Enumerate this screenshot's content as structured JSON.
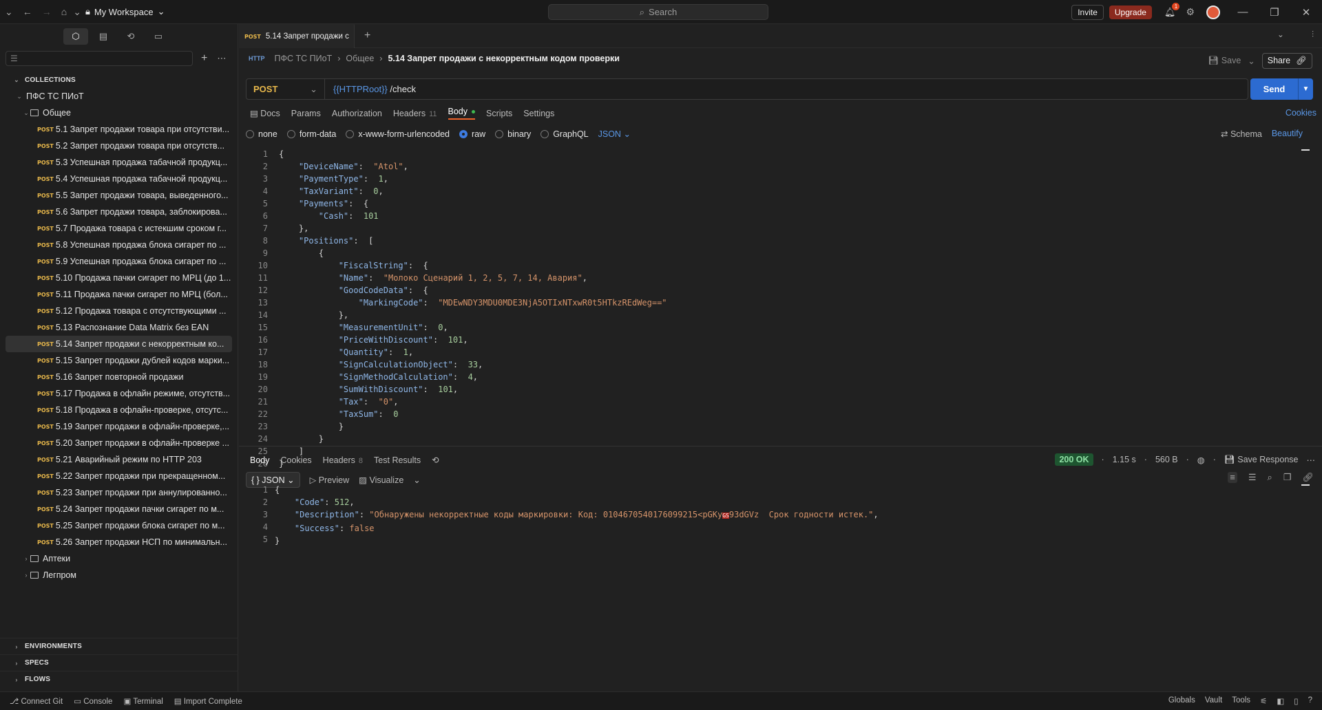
{
  "titlebar": {
    "workspace": "My Workspace",
    "search_placeholder": "Search",
    "invite": "Invite",
    "upgrade": "Upgrade",
    "notif_count": "1"
  },
  "sidebar": {
    "collections_label": "COLLECTIONS",
    "collection_name": "ПФС ТС ПИоТ",
    "folder_name": "Общее",
    "requests": [
      {
        "method": "POST",
        "name": "5.1 Запрет продажи товара при отсутстви..."
      },
      {
        "method": "POST",
        "name": "5.2 Запрет продажи товара при отсутств..."
      },
      {
        "method": "POST",
        "name": "5.3 Успешная продажа табачной продукц..."
      },
      {
        "method": "POST",
        "name": "5.4 Успешная продажа табачной продукц..."
      },
      {
        "method": "POST",
        "name": "5.5 Запрет продажи товара, выведенного..."
      },
      {
        "method": "POST",
        "name": "5.6 Запрет продажи товара, заблокирова..."
      },
      {
        "method": "POST",
        "name": "5.7 Продажа товара с истекшим сроком г..."
      },
      {
        "method": "POST",
        "name": "5.8 Успешная продажа блока сигарет по ..."
      },
      {
        "method": "POST",
        "name": "5.9 Успешная продажа блока сигарет по ..."
      },
      {
        "method": "POST",
        "name": "5.10 Продажа пачки сигарет по МРЦ (до 1..."
      },
      {
        "method": "POST",
        "name": "5.11 Продажа пачки сигарет по МРЦ (бол..."
      },
      {
        "method": "POST",
        "name": "5.12 Продажа товара с отсутствующими ..."
      },
      {
        "method": "POST",
        "name": "5.13 Распознание Data Matrix без EAN"
      },
      {
        "method": "POST",
        "name": "5.14 Запрет продажи с некорректным ко..."
      },
      {
        "method": "POST",
        "name": "5.15 Запрет продажи дублей кодов марки..."
      },
      {
        "method": "POST",
        "name": "5.16 Запрет повторной продажи"
      },
      {
        "method": "POST",
        "name": "5.17 Продажа в офлайн режиме, отсутств..."
      },
      {
        "method": "POST",
        "name": "5.18 Продажа в офлайн-проверке, отсутс..."
      },
      {
        "method": "POST",
        "name": "5.19 Запрет продажи в офлайн-проверке,..."
      },
      {
        "method": "POST",
        "name": "5.20 Запрет продажи в офлайн-проверке ..."
      },
      {
        "method": "POST",
        "name": "5.21 Аварийный режим по HTTP 203"
      },
      {
        "method": "POST",
        "name": "5.22 Запрет продажи при прекращенном..."
      },
      {
        "method": "POST",
        "name": "5.23 Запрет продажи при аннулированно..."
      },
      {
        "method": "POST",
        "name": "5.24 Запрет продажи пачки сигарет по м..."
      },
      {
        "method": "POST",
        "name": "5.25 Запрет продажи блока сигарет по м..."
      },
      {
        "method": "POST",
        "name": "5.26 Запрет продажи НСП по минимальн..."
      }
    ],
    "other_folders": [
      "Аптеки",
      "Легпром"
    ],
    "bottom_sections": [
      "ENVIRONMENTS",
      "SPECS",
      "FLOWS"
    ]
  },
  "tab": {
    "method": "POST",
    "title": "5.14 Запрет продажи с"
  },
  "breadcrumb": {
    "collection": "ПФС ТС ПИоТ",
    "folder": "Общее",
    "request": "5.14 Запрет продажи с некорректным кодом проверки"
  },
  "request": {
    "save": "Save",
    "share": "Share",
    "method": "POST",
    "url_var": "{{HTTPRoot}}",
    "url_path": " /check",
    "send": "Send",
    "subtabs": {
      "docs": "Docs",
      "params": "Params",
      "authorization": "Authorization",
      "headers": "Headers",
      "headers_count": "11",
      "body": "Body",
      "scripts": "Scripts",
      "settings": "Settings"
    },
    "cookies": "Cookies",
    "body_types": {
      "none": "none",
      "form_data": "form-data",
      "urlencoded": "x-www-form-urlencoded",
      "raw": "raw",
      "binary": "binary",
      "graphql": "GraphQL",
      "format": "JSON"
    },
    "schema": "Schema",
    "beautify": "Beautify"
  },
  "response": {
    "tabs": {
      "body": "Body",
      "cookies": "Cookies",
      "headers": "Headers",
      "headers_count": "8",
      "tests": "Test Results"
    },
    "status": "200 OK",
    "time": "1.15 s",
    "size": "560 B",
    "save_response": "Save Response",
    "format": "{ } JSON",
    "preview": "Preview",
    "visualize": "Visualize"
  },
  "statusbar": {
    "left": [
      "Connect Git",
      "Console",
      "Terminal",
      "Import Complete"
    ],
    "right": [
      "Globals",
      "Vault",
      "Tools"
    ]
  },
  "colors": {
    "accent_send": "#2c6bd1",
    "post_method": "#e8b84b",
    "upgrade": "#8b2a1e",
    "status_ok": "#1e5530"
  }
}
